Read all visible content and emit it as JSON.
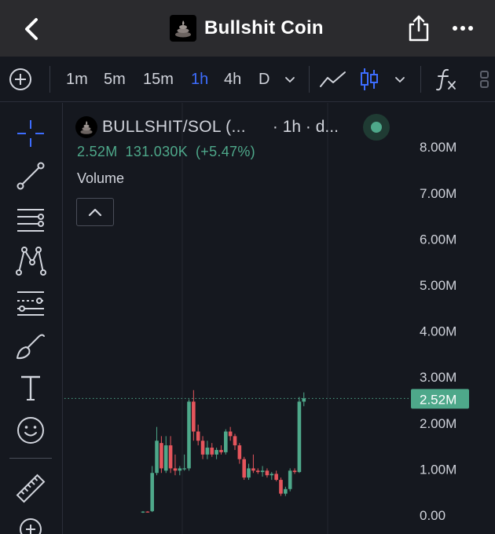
{
  "header": {
    "title": "Bullshit Coin",
    "icons": {
      "back": "chevron-left-icon",
      "share": "share-icon",
      "more": "more-horizontal-icon"
    }
  },
  "toolbar": {
    "intervals": [
      "1m",
      "5m",
      "15m",
      "1h",
      "4h",
      "D"
    ],
    "active_interval": "1h",
    "icons": [
      "add-circle-icon",
      "chevron-down-icon",
      "line-chart-icon",
      "candlestick-icon",
      "chevron-down-icon",
      "function-icon",
      "layout-icon"
    ]
  },
  "sidebar": {
    "tools": [
      "crosshair-icon",
      "trend-line-icon",
      "horizontal-lines-icon",
      "pattern-icon",
      "fib-retracement-icon",
      "brush-icon",
      "text-icon",
      "emoji-icon",
      "ruler-icon",
      "zoom-in-icon"
    ]
  },
  "legend": {
    "symbol": "BULLSHIT/SOL (...",
    "interval": "· 1h · d...",
    "last": "2.52M",
    "change": "131.030K",
    "change_pct": "(+5.47%)",
    "volume_label": "Volume"
  },
  "colors": {
    "up": "#4ea88a",
    "down": "#e5555c",
    "active": "#3d6dff",
    "background": "#15181f"
  },
  "chart_data": {
    "type": "candlestick",
    "price_axis": {
      "ticks": [
        "8.00M",
        "7.00M",
        "6.00M",
        "5.00M",
        "4.00M",
        "3.00M",
        "2.00M",
        "1.00M",
        "0.00"
      ],
      "values": [
        8,
        7,
        6,
        5,
        4,
        3,
        2,
        1,
        0
      ],
      "unit": "M",
      "range": [
        0,
        8.3
      ]
    },
    "last_price_label": "2.52M",
    "last_price": 2.52,
    "candles": [
      {
        "o": 0.05,
        "h": 0.07,
        "l": 0.03,
        "c": 0.06
      },
      {
        "o": 0.06,
        "h": 0.07,
        "l": 0.04,
        "c": 0.05
      },
      {
        "o": 0.07,
        "h": 1.05,
        "l": 0.05,
        "c": 0.9
      },
      {
        "o": 0.9,
        "h": 1.9,
        "l": 0.85,
        "c": 1.6
      },
      {
        "o": 1.55,
        "h": 1.7,
        "l": 0.9,
        "c": 1.0
      },
      {
        "o": 0.95,
        "h": 1.7,
        "l": 0.9,
        "c": 1.5
      },
      {
        "o": 1.5,
        "h": 1.7,
        "l": 0.9,
        "c": 1.0
      },
      {
        "o": 1.0,
        "h": 1.3,
        "l": 0.85,
        "c": 0.95
      },
      {
        "o": 0.95,
        "h": 1.05,
        "l": 0.85,
        "c": 1.0
      },
      {
        "o": 1.0,
        "h": 1.3,
        "l": 0.95,
        "c": 1.0
      },
      {
        "o": 1.0,
        "h": 2.5,
        "l": 0.95,
        "c": 2.45
      },
      {
        "o": 2.45,
        "h": 2.7,
        "l": 1.6,
        "c": 1.8
      },
      {
        "o": 1.8,
        "h": 1.95,
        "l": 1.5,
        "c": 1.6
      },
      {
        "o": 1.6,
        "h": 1.7,
        "l": 1.2,
        "c": 1.3
      },
      {
        "o": 1.3,
        "h": 1.6,
        "l": 1.2,
        "c": 1.45
      },
      {
        "o": 1.45,
        "h": 1.55,
        "l": 1.25,
        "c": 1.3
      },
      {
        "o": 1.3,
        "h": 1.45,
        "l": 1.2,
        "c": 1.4
      },
      {
        "o": 1.4,
        "h": 1.5,
        "l": 1.3,
        "c": 1.35
      },
      {
        "o": 1.35,
        "h": 1.85,
        "l": 1.3,
        "c": 1.8
      },
      {
        "o": 1.8,
        "h": 1.9,
        "l": 1.6,
        "c": 1.7
      },
      {
        "o": 1.7,
        "h": 1.75,
        "l": 1.4,
        "c": 1.5
      },
      {
        "o": 1.5,
        "h": 1.55,
        "l": 1.1,
        "c": 1.2
      },
      {
        "o": 1.2,
        "h": 1.25,
        "l": 0.75,
        "c": 0.8
      },
      {
        "o": 0.8,
        "h": 1.1,
        "l": 0.75,
        "c": 1.0
      },
      {
        "o": 1.0,
        "h": 1.3,
        "l": 0.9,
        "c": 0.95
      },
      {
        "o": 0.95,
        "h": 1.0,
        "l": 0.88,
        "c": 0.92
      },
      {
        "o": 0.92,
        "h": 1.05,
        "l": 0.82,
        "c": 0.95
      },
      {
        "o": 0.95,
        "h": 1.0,
        "l": 0.8,
        "c": 0.85
      },
      {
        "o": 0.85,
        "h": 0.92,
        "l": 0.75,
        "c": 0.88
      },
      {
        "o": 0.88,
        "h": 0.95,
        "l": 0.72,
        "c": 0.75
      },
      {
        "o": 0.75,
        "h": 0.8,
        "l": 0.4,
        "c": 0.45
      },
      {
        "o": 0.45,
        "h": 0.6,
        "l": 0.4,
        "c": 0.55
      },
      {
        "o": 0.55,
        "h": 1.0,
        "l": 0.5,
        "c": 0.95
      },
      {
        "o": 0.95,
        "h": 1.0,
        "l": 0.88,
        "c": 0.92
      },
      {
        "o": 0.92,
        "h": 2.55,
        "l": 0.9,
        "c": 2.45
      },
      {
        "o": 2.45,
        "h": 2.65,
        "l": 2.35,
        "c": 2.52
      }
    ]
  }
}
